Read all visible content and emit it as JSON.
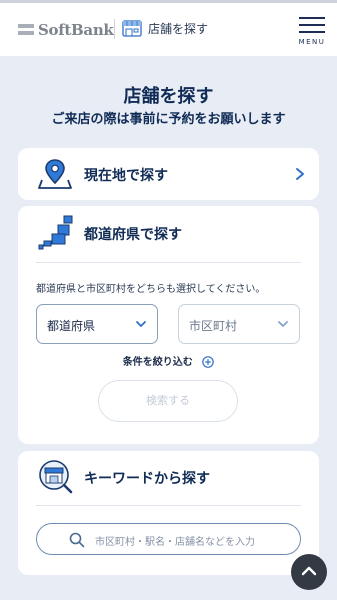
{
  "header": {
    "logo_text": "SoftBank",
    "store_label": "店舗を探す",
    "menu_label": "MENU"
  },
  "page": {
    "title": "店舗を探す",
    "subtitle": "ご来店の際は事前に予約をお願いします"
  },
  "current_location": {
    "title": "現在地で探す"
  },
  "prefecture_search": {
    "title": "都道府県で探す",
    "help_text": "都道府県と市区町村をどちらも選択してください。",
    "prefecture_select": "都道府県",
    "city_select": "市区町村",
    "narrow_label": "条件を絞り込む",
    "search_button": "検索する"
  },
  "keyword_search": {
    "title": "キーワードから探す",
    "placeholder": "市区町村・駅名・店舗名などを入力"
  },
  "colors": {
    "navy": "#102b55",
    "accent_blue": "#1f6fd1",
    "background": "#e8edf5"
  }
}
